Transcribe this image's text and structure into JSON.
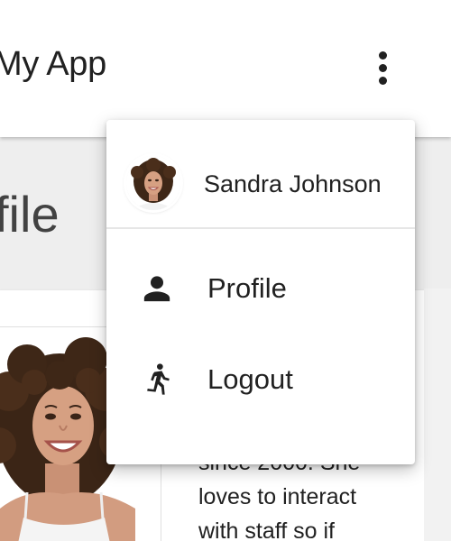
{
  "app_bar": {
    "title": "My App",
    "more_menu_icon": "more-vert-icon"
  },
  "page": {
    "heading": "file"
  },
  "profile_card": {
    "photo": "person-photo",
    "bio_lines": [
      "since 2000. She",
      "loves to interact",
      "with staff so if"
    ]
  },
  "user_menu": {
    "user_name": "Sandra Johnson",
    "avatar": "avatar-photo",
    "items": [
      {
        "label": "Profile",
        "icon": "person-icon"
      },
      {
        "label": "Logout",
        "icon": "run-icon"
      }
    ]
  },
  "colors": {
    "app_bar_bg": "#ffffff",
    "page_bg": "#eeeeee",
    "text": "#212121",
    "icon": "#212121"
  }
}
